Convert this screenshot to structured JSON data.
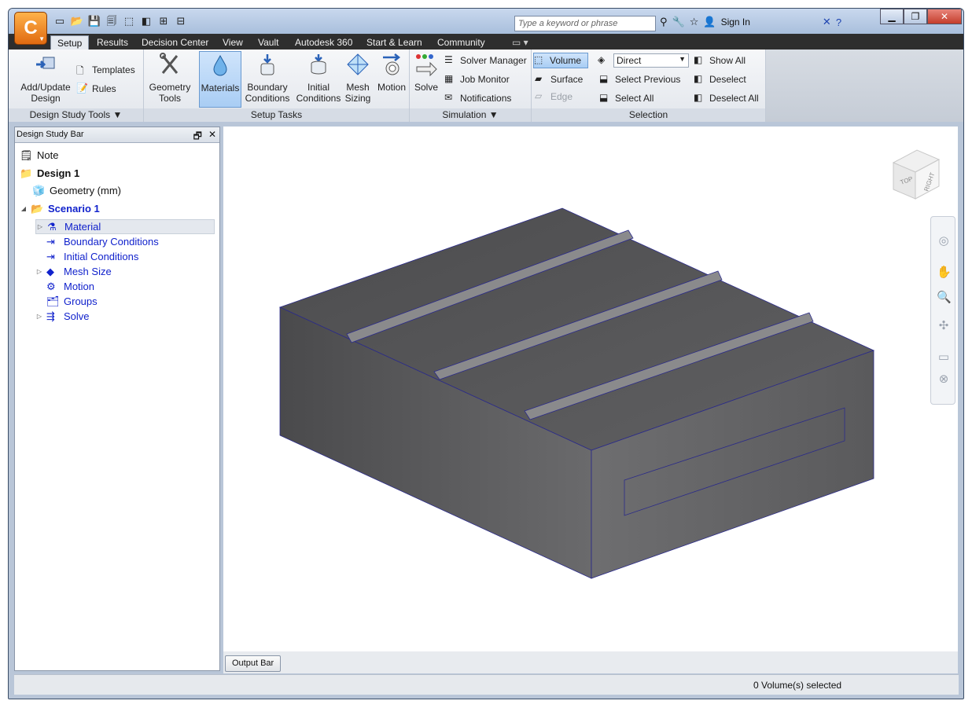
{
  "search": {
    "placeholder": "Type a keyword or phrase"
  },
  "header": {
    "sign_in": "Sign In"
  },
  "tabs": [
    "Setup",
    "Results",
    "Decision Center",
    "View",
    "Vault",
    "Autodesk 360",
    "Start & Learn",
    "Community"
  ],
  "ribbon": {
    "design_study_tools": {
      "label": "Design Study Tools ▼",
      "add_update_1": "Add/Update",
      "add_update_2": "Design",
      "templates": "Templates",
      "rules": "Rules"
    },
    "setup_tasks": {
      "label": "Setup Tasks",
      "geometry_1": "Geometry",
      "geometry_2": "Tools",
      "materials": "Materials",
      "boundary_1": "Boundary",
      "boundary_2": "Conditions",
      "initial_1": "Initial",
      "initial_2": "Conditions",
      "mesh_1": "Mesh",
      "mesh_2": "Sizing",
      "motion": "Motion"
    },
    "simulation": {
      "label": "Simulation ▼",
      "solve": "Solve",
      "solver_manager": "Solver Manager",
      "job_monitor": "Job Monitor",
      "notifications": "Notifications"
    },
    "selection": {
      "label": "Selection",
      "volume": "Volume",
      "surface": "Surface",
      "edge": "Edge",
      "direct": "Direct",
      "select_previous": "Select Previous",
      "select_all": "Select All",
      "show_all": "Show All",
      "deselect": "Deselect",
      "deselect_all": "Deselect All"
    }
  },
  "design_study_bar": {
    "title": "Design Study Bar",
    "tree": {
      "note": "Note",
      "design": "Design 1",
      "geometry": "Geometry (mm)",
      "scenario": "Scenario 1",
      "material": "Material",
      "boundary_conditions": "Boundary Conditions",
      "initial_conditions": "Initial Conditions",
      "mesh_size": "Mesh Size",
      "motion": "Motion",
      "groups": "Groups",
      "solve": "Solve"
    }
  },
  "viewcube": {
    "top": "TOP",
    "right": "RIGHT"
  },
  "output_bar": "Output Bar",
  "status": "0 Volume(s) selected",
  "colors": {
    "accent": "#1122cc",
    "model": "#555558",
    "edge": "#2a2a8a"
  }
}
